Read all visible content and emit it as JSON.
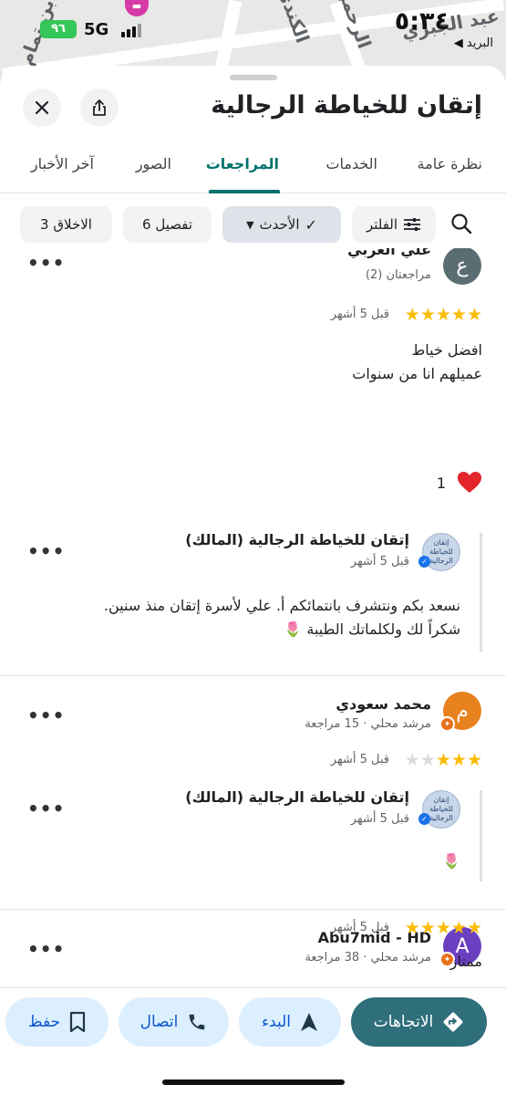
{
  "status": {
    "time": "٥:٣٤",
    "back_app": "◀ البريد",
    "battery": "٩٦",
    "network": "5G"
  },
  "map": {
    "labels": [
      "الكندي",
      "الرحمن",
      "ابن تمام",
      "عبد الجبري"
    ]
  },
  "place": {
    "title": "إتقان للخياطة الرجالية"
  },
  "tabs": [
    {
      "label": "نظرة عامة"
    },
    {
      "label": "الخدمات"
    },
    {
      "label": "المراجعات"
    },
    {
      "label": "الصور"
    },
    {
      "label": "آخر الأخبار"
    }
  ],
  "chips": {
    "filter": "الفلتر",
    "newest": "الأحدث",
    "detail": "تفصيل 6",
    "manners": "الاخلاق 3"
  },
  "reviews": [
    {
      "author": "علي العربي",
      "avatar_letter": "ع",
      "meta": "مراجعتان (2)",
      "rating": 5,
      "time": "قبل 5 أشهر",
      "text_lines": [
        "افضل خياط",
        "عميلهم انا من سنوات"
      ],
      "reaction_icon": "heart",
      "reaction_count": "1",
      "owner_reply": {
        "name": "إتقان للخياطة الرجالية (المالك)",
        "time": "قبل 5 أشهر",
        "text_lines": [
          "نسعد بكم ونتشرف بانتمائكم أ. علي لأسرة إتقان منذ سنين.",
          "شكراً لك ولكلماتك الطيبة 🌷"
        ]
      }
    },
    {
      "author": "محمد سعودي",
      "avatar_letter": "م",
      "meta": "مرشد محلي · 15 مراجعة",
      "rating": 3,
      "time": "قبل 5 أشهر",
      "owner_reply": {
        "name": "إتقان للخياطة الرجالية (المالك)",
        "time": "قبل 5 أشهر",
        "text": "🌷"
      }
    },
    {
      "author": "Abu7mid - HD",
      "avatar_letter": "A",
      "meta": "مرشد محلي · 38 مراجعة",
      "rating": 5,
      "time": "قبل 5 أشهر",
      "text": "ممتاز"
    }
  ],
  "owner_logo_text": "إتقان للخياطة الرجالية",
  "actions": {
    "directions": "الاتجاهات",
    "start": "البدء",
    "call": "اتصال",
    "save": "حفظ"
  },
  "colors": {
    "accent": "#00736c",
    "star": "#fbbc04",
    "primary_action": "#2f6e7b"
  }
}
